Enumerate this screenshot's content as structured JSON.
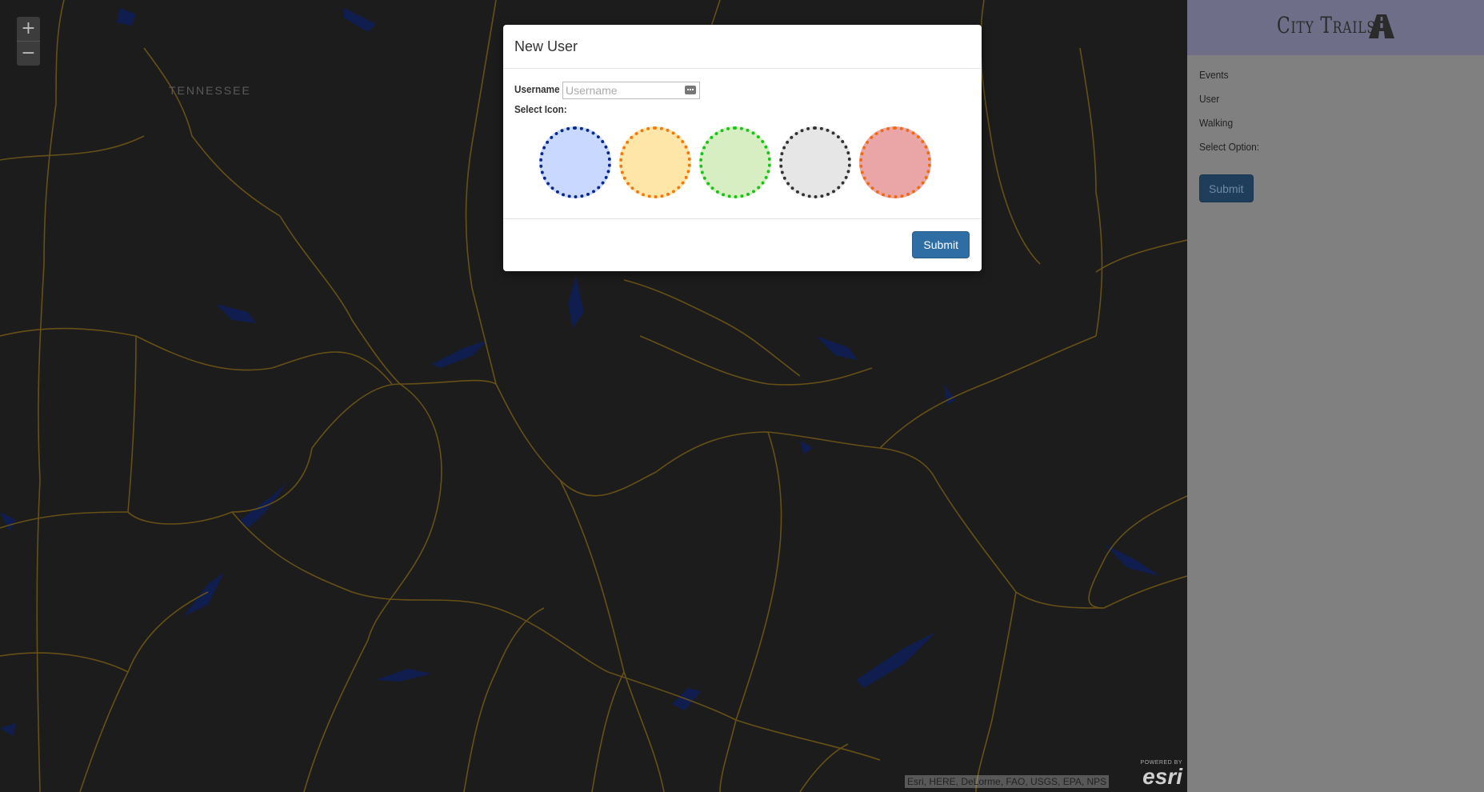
{
  "map": {
    "zoom_in_label": "+",
    "zoom_out_label": "−",
    "region_label": "TENNESSEE",
    "attribution": "Esri, HERE, DeLorme, FAO, USGS, EPA, NPS",
    "esri_powered": "POWERED BY",
    "esri_word": "esri",
    "colors": {
      "background": "#1c1c1c",
      "roads": "#6b5317",
      "water": "#0d1f4a"
    }
  },
  "modal": {
    "title": "New User",
    "username_label": "Username",
    "username_value": "",
    "username_placeholder": "Username",
    "select_icon_label": "Select Icon:",
    "icons": [
      {
        "name": "blue",
        "fill": "#c8d8ff",
        "border": "#0a2a8a"
      },
      {
        "name": "yellow",
        "fill": "#fde6a7",
        "border": "#f07a12"
      },
      {
        "name": "green",
        "fill": "#d7eec2",
        "border": "#17c417"
      },
      {
        "name": "gray",
        "fill": "#e6e6e6",
        "border": "#333333"
      },
      {
        "name": "red",
        "fill": "#eaa6a6",
        "border": "#f06a12"
      }
    ],
    "submit_label": "Submit"
  },
  "sidebar": {
    "brand": "City Trails",
    "brand_icon": "road-icon",
    "items": [
      {
        "label": "Events"
      },
      {
        "label": "User"
      },
      {
        "label": "Walking"
      },
      {
        "label": "Select Option:"
      }
    ],
    "submit_label": "Submit"
  }
}
